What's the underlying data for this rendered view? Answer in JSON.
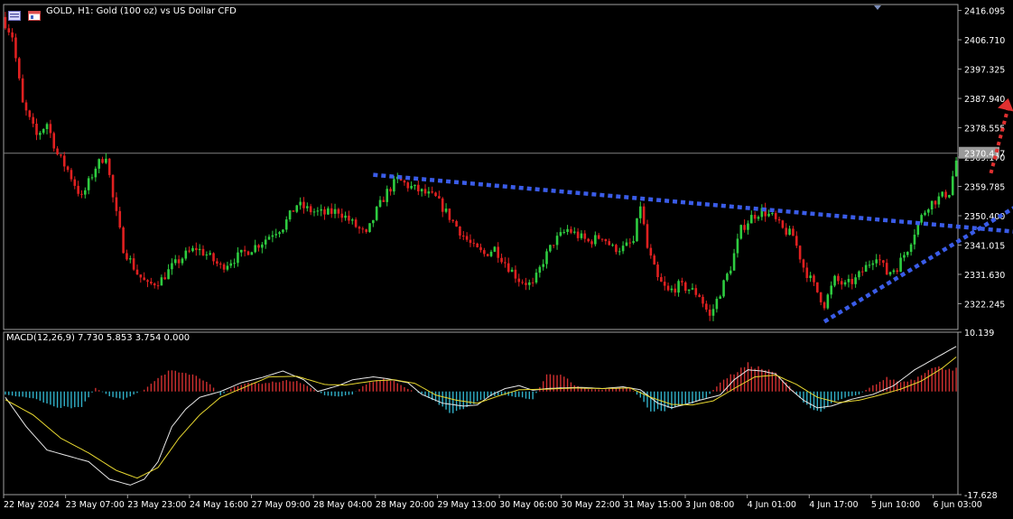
{
  "header": {
    "symbol_info": "GOLD, H1:  Gold (100 oz) vs US Dollar CFD"
  },
  "macd_label": "MACD(12,26,9) 7.730 5.853 3.754 0.000",
  "colors": {
    "background": "#000000",
    "grid_frame": "#a0a0a0",
    "bull_candle": "#2ecc40",
    "bear_candle": "#e02020",
    "trendline": "#3a5ce8",
    "arrow": "#e03030",
    "macd_hist_up": "#d03030",
    "macd_hist_down": "#30b0c8",
    "macd_line": "#e8e8e8",
    "signal_line": "#e8d830",
    "current_price_line": "#808080"
  },
  "chart_data": [
    {
      "type": "candlestick",
      "symbol": "GOLD",
      "timeframe": "H1",
      "ylim": [
        2314.0,
        2418.0
      ],
      "price_axis_ticks": [
        "2416.095",
        "2406.710",
        "2397.325",
        "2387.940",
        "2378.555",
        "2369.170",
        "2359.785",
        "2350.400",
        "2341.015",
        "2331.630",
        "2322.245"
      ],
      "price_axis_values": [
        2416.095,
        2406.71,
        2397.325,
        2387.94,
        2378.555,
        2369.17,
        2359.785,
        2350.4,
        2341.015,
        2331.63,
        2322.245
      ],
      "current_price_label": "2370.417",
      "current_price": 2370.417,
      "time_axis_labels": [
        "22 May 2024",
        "23 May 07:00",
        "23 May 23:00",
        "24 May 16:00",
        "27 May 09:00",
        "28 May 04:00",
        "28 May 20:00",
        "29 May 13:00",
        "30 May 06:00",
        "30 May 22:00",
        "31 May 15:00",
        "3 Jun 08:00",
        "4 Jun 01:00",
        "4 Jun 17:00",
        "5 Jun 10:00",
        "6 Jun 03:00"
      ],
      "close_path": [
        [
          0,
          2412
        ],
        [
          2,
          2408
        ],
        [
          5,
          2386
        ],
        [
          9,
          2376
        ],
        [
          12,
          2380
        ],
        [
          15,
          2370
        ],
        [
          18,
          2365
        ],
        [
          22,
          2356
        ],
        [
          26,
          2366
        ],
        [
          29,
          2370
        ],
        [
          31,
          2356
        ],
        [
          34,
          2340
        ],
        [
          38,
          2332
        ],
        [
          41,
          2328
        ],
        [
          45,
          2330
        ],
        [
          48,
          2334
        ],
        [
          52,
          2338
        ],
        [
          55,
          2340
        ],
        [
          58,
          2338
        ],
        [
          62,
          2334
        ],
        [
          65,
          2336
        ],
        [
          68,
          2338
        ],
        [
          71,
          2340
        ],
        [
          74,
          2342
        ],
        [
          77,
          2345
        ],
        [
          80,
          2347
        ],
        [
          84,
          2354
        ],
        [
          88,
          2352
        ],
        [
          92,
          2351
        ],
        [
          96,
          2352
        ],
        [
          100,
          2348
        ],
        [
          104,
          2344
        ],
        [
          107,
          2352
        ],
        [
          110,
          2358
        ],
        [
          113,
          2362
        ],
        [
          116,
          2360
        ],
        [
          120,
          2358
        ],
        [
          124,
          2356
        ],
        [
          128,
          2350
        ],
        [
          132,
          2344
        ],
        [
          135,
          2340
        ],
        [
          138,
          2338
        ],
        [
          141,
          2340
        ],
        [
          145,
          2334
        ],
        [
          148,
          2330
        ],
        [
          152,
          2328
        ],
        [
          155,
          2336
        ],
        [
          158,
          2342
        ],
        [
          162,
          2346
        ],
        [
          165,
          2344
        ],
        [
          168,
          2342
        ],
        [
          172,
          2344
        ],
        [
          175,
          2340
        ],
        [
          178,
          2340
        ],
        [
          181,
          2342
        ],
        [
          183,
          2354
        ],
        [
          185,
          2340
        ],
        [
          188,
          2330
        ],
        [
          191,
          2326
        ],
        [
          194,
          2328
        ],
        [
          197,
          2327
        ],
        [
          200,
          2325
        ],
        [
          203,
          2318
        ],
        [
          206,
          2326
        ],
        [
          209,
          2334
        ],
        [
          212,
          2346
        ],
        [
          215,
          2350
        ],
        [
          218,
          2352
        ],
        [
          221,
          2350
        ],
        [
          224,
          2346
        ],
        [
          227,
          2344
        ],
        [
          230,
          2334
        ],
        [
          233,
          2328
        ],
        [
          236,
          2322
        ],
        [
          239,
          2330
        ],
        [
          242,
          2328
        ],
        [
          245,
          2330
        ],
        [
          248,
          2334
        ],
        [
          251,
          2338
        ],
        [
          254,
          2332
        ],
        [
          257,
          2334
        ],
        [
          260,
          2340
        ],
        [
          263,
          2348
        ],
        [
          266,
          2354
        ],
        [
          269,
          2356
        ],
        [
          272,
          2358
        ],
        [
          274,
          2368
        ]
      ],
      "annotations": [
        {
          "type": "resistance-trendline",
          "style": "dotted",
          "from": [
            106,
            2363.5
          ],
          "to": [
            299,
            2344.5
          ]
        },
        {
          "type": "support-trendline",
          "style": "dotted",
          "from": [
            236,
            2316.5
          ],
          "to": [
            296,
            2356.5
          ]
        },
        {
          "type": "up-arrow",
          "style": "dotted",
          "from": [
            284,
            2364
          ],
          "to": [
            289,
            2388
          ]
        }
      ]
    },
    {
      "type": "bar-line",
      "name": "MACD(12,26,9)",
      "values_label": "7.730 5.853 3.754 0.000",
      "ylim": [
        -17.628,
        10.139
      ],
      "axis_ticks": [
        "10.139",
        "-17.628"
      ],
      "axis_values": [
        10.139,
        -17.628
      ],
      "histogram_path": [
        [
          0,
          -0.5
        ],
        [
          8,
          -1.2
        ],
        [
          16,
          -2.8
        ],
        [
          22,
          -2.5
        ],
        [
          26,
          0.6
        ],
        [
          30,
          -0.8
        ],
        [
          34,
          -1.4
        ],
        [
          40,
          0.3
        ],
        [
          44,
          2.2
        ],
        [
          48,
          3.7
        ],
        [
          52,
          3.4
        ],
        [
          58,
          1.8
        ],
        [
          62,
          -0.6
        ],
        [
          66,
          0.8
        ],
        [
          70,
          1.5
        ],
        [
          74,
          1.3
        ],
        [
          78,
          1.7
        ],
        [
          84,
          1.9
        ],
        [
          88,
          0.6
        ],
        [
          92,
          -0.6
        ],
        [
          96,
          -0.9
        ],
        [
          100,
          -0.5
        ],
        [
          104,
          1.3
        ],
        [
          108,
          2.1
        ],
        [
          112,
          1.8
        ],
        [
          116,
          0.4
        ],
        [
          120,
          -0.4
        ],
        [
          124,
          -1.8
        ],
        [
          128,
          -3.6
        ],
        [
          132,
          -3.2
        ],
        [
          136,
          -1.6
        ],
        [
          140,
          -0.8
        ],
        [
          144,
          -0.6
        ],
        [
          148,
          -1.0
        ],
        [
          152,
          -1.3
        ],
        [
          156,
          2.8
        ],
        [
          160,
          3.1
        ],
        [
          164,
          1.0
        ],
        [
          168,
          0.4
        ],
        [
          172,
          0.3
        ],
        [
          176,
          0.6
        ],
        [
          180,
          0.7
        ],
        [
          183,
          -1.1
        ],
        [
          186,
          -3.3
        ],
        [
          190,
          -3.2
        ],
        [
          194,
          -2.6
        ],
        [
          198,
          -1.9
        ],
        [
          202,
          -1.1
        ],
        [
          206,
          1.6
        ],
        [
          210,
          3.1
        ],
        [
          214,
          4.6
        ],
        [
          218,
          3.9
        ],
        [
          222,
          3.1
        ],
        [
          226,
          0.9
        ],
        [
          230,
          -1.9
        ],
        [
          234,
          -3.6
        ],
        [
          238,
          -2.0
        ],
        [
          242,
          -1.0
        ],
        [
          246,
          -0.5
        ],
        [
          250,
          1.0
        ],
        [
          254,
          2.3
        ],
        [
          258,
          1.6
        ],
        [
          262,
          2.1
        ],
        [
          266,
          3.9
        ],
        [
          270,
          4.1
        ],
        [
          274,
          3.8
        ]
      ],
      "macd_path": [
        [
          0,
          -1
        ],
        [
          6,
          -6
        ],
        [
          12,
          -10
        ],
        [
          18,
          -11
        ],
        [
          24,
          -12
        ],
        [
          30,
          -15
        ],
        [
          36,
          -16
        ],
        [
          40,
          -15
        ],
        [
          44,
          -12
        ],
        [
          48,
          -6
        ],
        [
          52,
          -3
        ],
        [
          56,
          -1
        ],
        [
          62,
          0
        ],
        [
          68,
          1.5
        ],
        [
          74,
          2.4
        ],
        [
          80,
          3.5
        ],
        [
          86,
          2
        ],
        [
          90,
          0
        ],
        [
          96,
          1
        ],
        [
          100,
          2
        ],
        [
          106,
          2.5
        ],
        [
          110,
          2.2
        ],
        [
          116,
          1.5
        ],
        [
          120,
          -0.5
        ],
        [
          126,
          -2
        ],
        [
          132,
          -2.5
        ],
        [
          136,
          -2.3
        ],
        [
          140,
          -0.6
        ],
        [
          144,
          0.5
        ],
        [
          148,
          1
        ],
        [
          152,
          0.2
        ],
        [
          156,
          0.5
        ],
        [
          160,
          0.6
        ],
        [
          166,
          0.7
        ],
        [
          172,
          0.5
        ],
        [
          178,
          0.8
        ],
        [
          183,
          0.3
        ],
        [
          188,
          -2
        ],
        [
          192,
          -2.8
        ],
        [
          196,
          -2.2
        ],
        [
          200,
          -1.5
        ],
        [
          206,
          -0.6
        ],
        [
          210,
          2
        ],
        [
          214,
          3.7
        ],
        [
          218,
          3.5
        ],
        [
          222,
          3
        ],
        [
          226,
          0.5
        ],
        [
          230,
          -1.5
        ],
        [
          234,
          -2.8
        ],
        [
          238,
          -2.5
        ],
        [
          244,
          -1.3
        ],
        [
          250,
          -0.5
        ],
        [
          256,
          1
        ],
        [
          262,
          3.7
        ],
        [
          268,
          5.7
        ],
        [
          274,
          7.7
        ]
      ],
      "signal_path": [
        [
          0,
          -1.4
        ],
        [
          8,
          -4
        ],
        [
          16,
          -8
        ],
        [
          24,
          -10.5
        ],
        [
          32,
          -13.5
        ],
        [
          38,
          -14.8
        ],
        [
          44,
          -13
        ],
        [
          50,
          -8
        ],
        [
          56,
          -4
        ],
        [
          62,
          -1
        ],
        [
          68,
          0.5
        ],
        [
          76,
          2.5
        ],
        [
          84,
          2.6
        ],
        [
          92,
          1.2
        ],
        [
          98,
          1.1
        ],
        [
          106,
          1.8
        ],
        [
          112,
          2
        ],
        [
          118,
          1.4
        ],
        [
          124,
          -0.6
        ],
        [
          130,
          -1.5
        ],
        [
          136,
          -2
        ],
        [
          142,
          -0.8
        ],
        [
          148,
          0.3
        ],
        [
          156,
          0.4
        ],
        [
          164,
          0.6
        ],
        [
          172,
          0.5
        ],
        [
          180,
          0.6
        ],
        [
          186,
          -1
        ],
        [
          192,
          -2.2
        ],
        [
          198,
          -2.3
        ],
        [
          204,
          -1.6
        ],
        [
          210,
          0.5
        ],
        [
          216,
          2.5
        ],
        [
          222,
          2.8
        ],
        [
          228,
          1.2
        ],
        [
          234,
          -1
        ],
        [
          240,
          -1.9
        ],
        [
          246,
          -1.5
        ],
        [
          252,
          -0.6
        ],
        [
          258,
          0.4
        ],
        [
          264,
          1.8
        ],
        [
          270,
          4
        ],
        [
          274,
          5.9
        ]
      ]
    }
  ]
}
